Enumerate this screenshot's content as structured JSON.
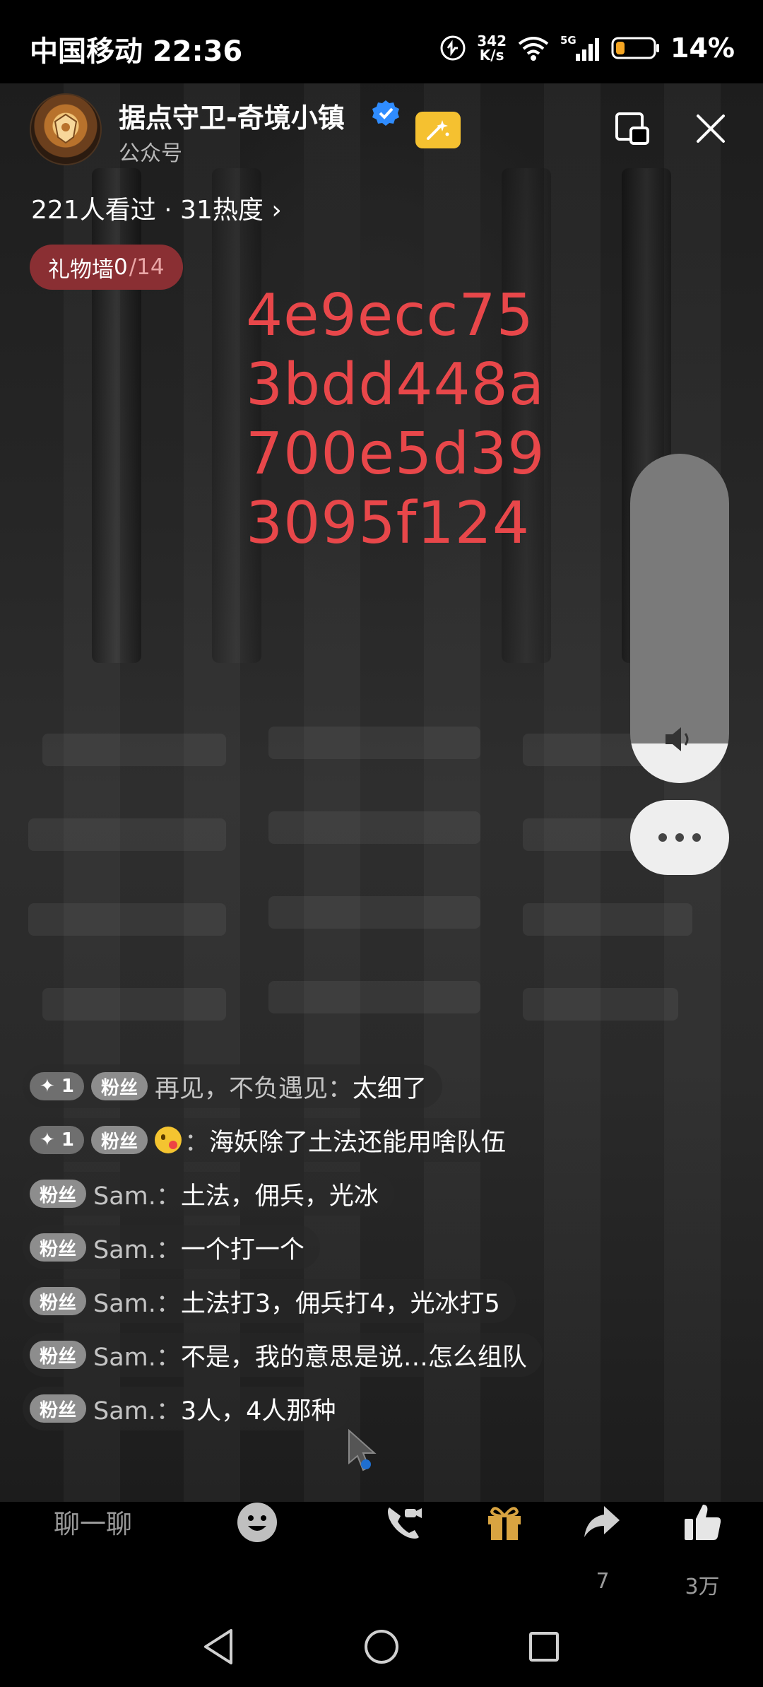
{
  "status_bar": {
    "carrier_time": "中国移动 22:36",
    "net_speed_value": "342",
    "net_speed_unit": "K/s",
    "network": "5G",
    "battery_percent": "14%",
    "icons": [
      "nfc-icon",
      "wifi-icon",
      "signal-icon",
      "battery-icon"
    ]
  },
  "header": {
    "channel_name": "据点守卫-奇境小镇",
    "channel_type": "公众号",
    "verified_icon": "verified-badge-icon",
    "badge_icon": "star-sparkle-icon",
    "stats": "221人看过 · 31热度",
    "stats_chevron": "›",
    "gift_wall_label": "礼物墙",
    "gift_wall_count": "0",
    "gift_wall_total": "/14"
  },
  "overlay_code": [
    "4e9ecc75",
    "3bdd448a",
    "700e5d39",
    "3095f124"
  ],
  "controls": {
    "volume_level_fraction": 0.12,
    "volume_icon": "speaker-icon",
    "more_icon": "more-dots-icon",
    "pip_icon": "picture-in-picture-icon",
    "close_icon": "close-icon"
  },
  "chat": [
    {
      "plus": "1",
      "tag": "粉丝",
      "user": "再见，不负遇见：",
      "text": "太细了",
      "emoji": false
    },
    {
      "plus": "1",
      "tag": "粉丝",
      "user": "：",
      "text": "海妖除了土法还能用啥队伍",
      "emoji": true
    },
    {
      "plus": null,
      "tag": "粉丝",
      "user": "Sam.：",
      "text": "土法，佣兵，光冰",
      "emoji": false
    },
    {
      "plus": null,
      "tag": "粉丝",
      "user": "Sam.：",
      "text": "一个打一个",
      "emoji": false
    },
    {
      "plus": null,
      "tag": "粉丝",
      "user": "Sam.：",
      "text": "土法打3，佣兵打4，光冰打5",
      "emoji": false
    },
    {
      "plus": null,
      "tag": "粉丝",
      "user": "Sam.：",
      "text": "不是，我的意思是说…怎么组队",
      "emoji": false
    },
    {
      "plus": null,
      "tag": "粉丝",
      "user": "Sam.：",
      "text": "3人，4人那种",
      "emoji": false
    }
  ],
  "bottom_bar": {
    "chat_placeholder": "聊一聊",
    "share_count": "7",
    "like_count": "3万",
    "icons": [
      "emoji-icon",
      "video-call-icon",
      "gift-icon",
      "share-icon",
      "like-icon"
    ]
  },
  "nav_bar": {
    "icons": [
      "back-icon",
      "home-icon",
      "recents-icon"
    ]
  },
  "colors": {
    "overlay_text": "#e8474a",
    "gift_wall_bg": "#8a2f33",
    "gift_icon": "#d9a441",
    "verified": "#2f8cff",
    "star_badge": "#f5c130"
  }
}
